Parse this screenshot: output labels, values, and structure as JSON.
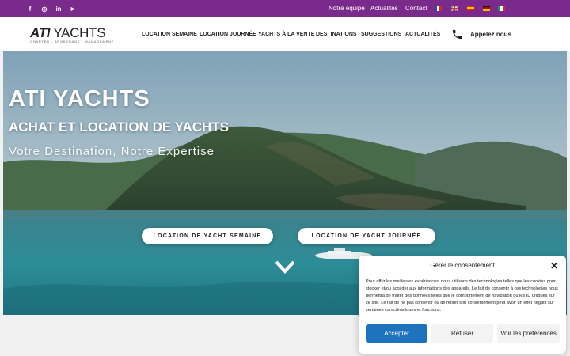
{
  "topbar": {
    "social": [
      {
        "name": "facebook-icon",
        "glyph": "f"
      },
      {
        "name": "instagram-icon",
        "glyph": "◎"
      },
      {
        "name": "linkedin-icon",
        "glyph": "in"
      },
      {
        "name": "youtube-icon",
        "glyph": "▶"
      }
    ],
    "links": [
      "Notre équipe",
      "Actualités",
      "Contact"
    ],
    "flags": [
      "flag-fr-icon",
      "flag-uk-icon",
      "flag-es-icon",
      "flag-de-icon",
      "flag-it-icon"
    ]
  },
  "header": {
    "logo_bold": "ATI",
    "logo_light": "YACHTS",
    "logo_sub": "CHARTER - BROKERAGE - MANAGEMENT",
    "nav": [
      "LOCATION SEMAINE",
      "LOCATION JOURNÉE",
      "YACHTS À LA VENTE",
      "DESTINATIONS",
      "SUGGESTIONS",
      "ACTUALITÉS"
    ],
    "call_label": "Appelez nous"
  },
  "hero": {
    "title": "ATI YACHTS",
    "subtitle": "ACHAT ET LOCATION DE YACHTS",
    "tagline": "Votre Destination, Notre Expertise",
    "cta_week": "LOCATION DE YACHT SEMAINE",
    "cta_day": "LOCATION DE YACHT JOURNÉE"
  },
  "cookie": {
    "title": "Gérer le consentement",
    "close": "✕",
    "text": "Pour offrir les meilleures expériences, nous utilisons des technologies telles que les cookies pour stocker et/ou accéder aux informations des appareils. Le fait de consentir à ces technologies nous permettra de traiter des données telles que le comportement de navigation ou les ID uniques sur ce site. Le fait de ne pas consentir ou de retirer son consentement peut avoir un effet négatif sur certaines caractéristiques et fonctions.",
    "accept": "Accepter",
    "refuse": "Refuser",
    "preferences": "Voir les préférences"
  },
  "colors": {
    "topbar": "#7a2a8a",
    "accept": "#1e73be",
    "secondary_button": "#f3f3f3"
  }
}
